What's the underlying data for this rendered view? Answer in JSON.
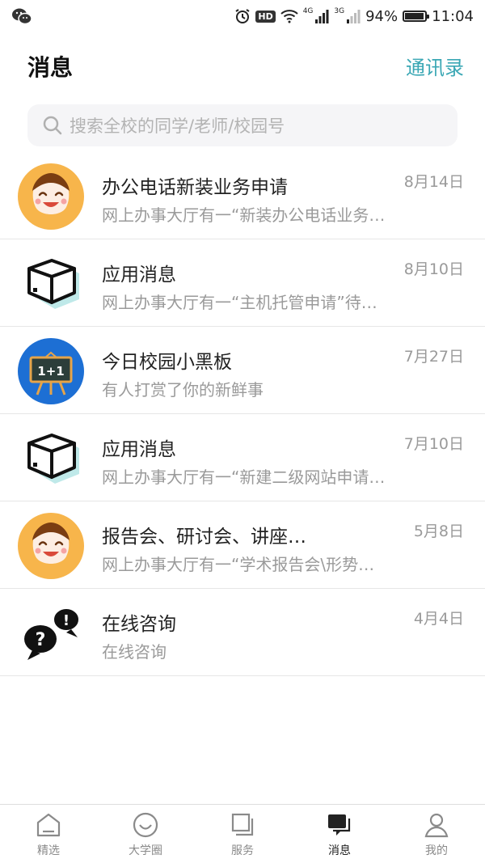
{
  "status_bar": {
    "time": "11:04",
    "battery": "94%",
    "battery_level": 0.94,
    "hd": "HD",
    "net1": "4G",
    "net2": "3G"
  },
  "header": {
    "title": "消息",
    "contacts": "通讯录"
  },
  "search": {
    "placeholder": "搜索全校的同学/老师/校园号"
  },
  "messages": [
    {
      "icon": "smiley-face-icon",
      "title": "办公电话新装业务申请",
      "preview": "网上办事大厅有一“新装办公电话业务申请”",
      "date": "8月14日"
    },
    {
      "icon": "box-icon",
      "title": "应用消息",
      "preview": "网上办事大厅有一“主机托管申请”待办事项",
      "date": "8月10日"
    },
    {
      "icon": "blackboard-icon",
      "title": "今日校园小黑板",
      "preview": "有人打赏了你的新鲜事",
      "date": "7月27日"
    },
    {
      "icon": "box-icon",
      "title": "应用消息",
      "preview": "网上办事大厅有一“新建二级网站申请”待办",
      "date": "7月10日"
    },
    {
      "icon": "smiley-face-icon",
      "title": "报告会、研讨会、讲座…",
      "preview": "网上办事大厅有一“学术报告会\\形势报告会”",
      "date": "5月8日"
    },
    {
      "icon": "chat-bubbles-icon",
      "title": "在线咨询",
      "preview": "在线咨询",
      "date": "4月4日"
    }
  ],
  "nav": [
    {
      "label": "精选",
      "icon": "home-icon",
      "active": false
    },
    {
      "label": "大学圈",
      "icon": "smile-circle-icon",
      "active": false
    },
    {
      "label": "服务",
      "icon": "layers-icon",
      "active": false
    },
    {
      "label": "消息",
      "icon": "message-icon",
      "active": true
    },
    {
      "label": "我的",
      "icon": "person-icon",
      "active": false
    }
  ],
  "colors": {
    "accent": "#3aa7b4",
    "avatar_orange": "#f7b54b",
    "board_blue": "#1d6fd4"
  }
}
